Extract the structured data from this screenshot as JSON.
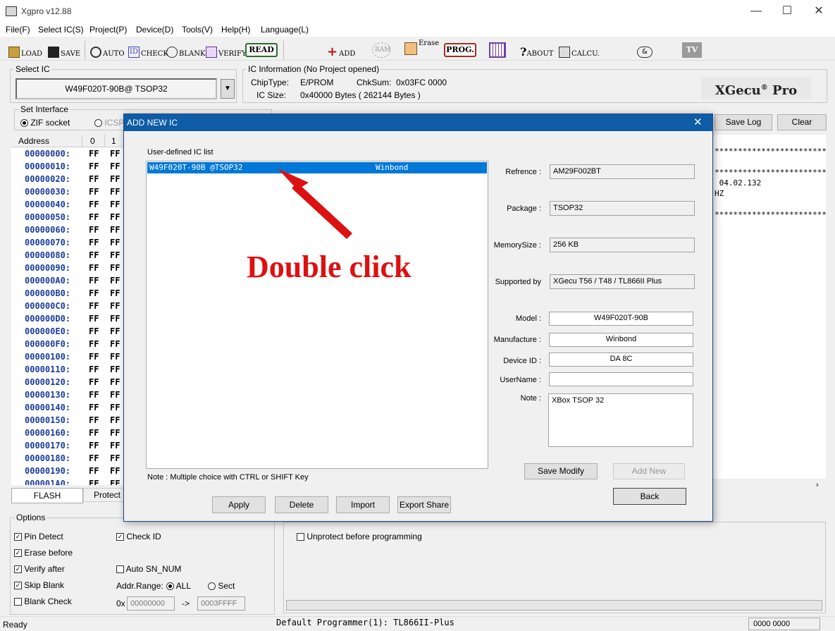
{
  "window": {
    "title": "Xgpro v12.88",
    "min": "—",
    "max": "☐",
    "close": "✕"
  },
  "menu": [
    "File(F)",
    "Select IC(S)",
    "Project(P)",
    "Device(D)",
    "Tools(V)",
    "Help(H)",
    "Language(L)"
  ],
  "toolbar": {
    "load": "LOAD",
    "save": "SAVE",
    "auto": "AUTO",
    "check": "CHECK",
    "blank": "BLANK",
    "verify": "VERIFY",
    "read": "READ",
    "add": "ADD",
    "ram": "RAM",
    "erase": "Erase",
    "prog": "PROG.",
    "about": "ABOUT",
    "calcu": "CALCU.",
    "logic": "&",
    "tv": "TV"
  },
  "select_ic": {
    "label": "Select IC",
    "value": "W49F020T-90B@ TSOP32"
  },
  "ic_info": {
    "label": "IC Information (No Project opened)",
    "chiptype_label": "ChipType:",
    "chiptype": "E/PROM",
    "chksum_label": "ChkSum:",
    "chksum": "0x03FC 0000",
    "icsize_label": "IC Size:",
    "icsize": "0x40000 Bytes ( 262144 Bytes )",
    "brand": "XGecu",
    "brand_mark": "®",
    "brand_suffix": "Pro"
  },
  "interface": {
    "label": "Set Interface",
    "zif": "ZIF socket",
    "icsp": "ICSP"
  },
  "log": {
    "save_log": "Save Log",
    "clear": "Clear",
    "lines": [
      "*******************************",
      "",
      "*******************************",
      " 04.02.132",
      "HZ",
      "",
      "*******************************"
    ]
  },
  "hex": {
    "col_address": "Address",
    "col0": "0",
    "col1": "1",
    "rows": [
      {
        "addr": "00000000:",
        "v0": "FF",
        "v1": "FF"
      },
      {
        "addr": "00000010:",
        "v0": "FF",
        "v1": "FF"
      },
      {
        "addr": "00000020:",
        "v0": "FF",
        "v1": "FF"
      },
      {
        "addr": "00000030:",
        "v0": "FF",
        "v1": "FF"
      },
      {
        "addr": "00000040:",
        "v0": "FF",
        "v1": "FF"
      },
      {
        "addr": "00000050:",
        "v0": "FF",
        "v1": "FF"
      },
      {
        "addr": "00000060:",
        "v0": "FF",
        "v1": "FF"
      },
      {
        "addr": "00000070:",
        "v0": "FF",
        "v1": "FF"
      },
      {
        "addr": "00000080:",
        "v0": "FF",
        "v1": "FF"
      },
      {
        "addr": "00000090:",
        "v0": "FF",
        "v1": "FF"
      },
      {
        "addr": "000000A0:",
        "v0": "FF",
        "v1": "FF"
      },
      {
        "addr": "000000B0:",
        "v0": "FF",
        "v1": "FF"
      },
      {
        "addr": "000000C0:",
        "v0": "FF",
        "v1": "FF"
      },
      {
        "addr": "000000D0:",
        "v0": "FF",
        "v1": "FF"
      },
      {
        "addr": "000000E0:",
        "v0": "FF",
        "v1": "FF"
      },
      {
        "addr": "000000F0:",
        "v0": "FF",
        "v1": "FF"
      },
      {
        "addr": "00000100:",
        "v0": "FF",
        "v1": "FF"
      },
      {
        "addr": "00000110:",
        "v0": "FF",
        "v1": "FF"
      },
      {
        "addr": "00000120:",
        "v0": "FF",
        "v1": "FF"
      },
      {
        "addr": "00000130:",
        "v0": "FF",
        "v1": "FF"
      },
      {
        "addr": "00000140:",
        "v0": "FF",
        "v1": "FF"
      },
      {
        "addr": "00000150:",
        "v0": "FF",
        "v1": "FF"
      },
      {
        "addr": "00000160:",
        "v0": "FF",
        "v1": "FF"
      },
      {
        "addr": "00000170:",
        "v0": "FF",
        "v1": "FF"
      },
      {
        "addr": "00000180:",
        "v0": "FF",
        "v1": "FF"
      },
      {
        "addr": "00000190:",
        "v0": "FF",
        "v1": "FF"
      },
      {
        "addr": "000001A0:",
        "v0": "FF",
        "v1": "FF"
      }
    ]
  },
  "tabs": {
    "flash": "FLASH",
    "protect": "Protect"
  },
  "options": {
    "label": "Options",
    "pin_detect": "Pin Detect",
    "check_id": "Check ID",
    "erase_before": "Erase before",
    "verify_after": "Verify after",
    "auto_sn": "Auto SN_NUM",
    "skip_blank": "Skip Blank",
    "addr_range": "Addr.Range:",
    "all": "ALL",
    "sect": "Sect",
    "blank_check": "Blank Check",
    "ox": "0x",
    "from": "00000000",
    "arrow": "->",
    "to": "0003FFFF",
    "check": "✓"
  },
  "protect": {
    "unprotect": "Unprotect before programming"
  },
  "status": {
    "ready": "Ready",
    "programmer": "Default Programmer(1): TL866II-Plus",
    "code": "0000 0000"
  },
  "dialog": {
    "title": "ADD NEW IC",
    "close": "✕",
    "list_label": "User-defined IC list",
    "items": [
      {
        "name": "W49F020T-90B @TSOP32",
        "maker": "Winbond"
      }
    ],
    "annotation": "Double click",
    "note_hint": "Note : Multiple choice with CTRL or SHIFT Key",
    "fields": {
      "refrence_label": "Refrence :",
      "refrence": "AM29F002BT",
      "package_label": "Package :",
      "package": "TSOP32",
      "memsize_label": "MemorySize :",
      "memsize": "256 KB",
      "supported_label": "Supported by",
      "supported": "XGecu T56 / T48 / TL866II Plus",
      "model_label": "Model :",
      "model": "W49F020T-90B",
      "manufacture_label": "Manufacture :",
      "manufacture": "Winbond",
      "deviceid_label": "Device ID :",
      "deviceid": "DA 8C",
      "username_label": "UserName :",
      "username": "",
      "note_label": "Note :",
      "note": "XBox TSOP 32"
    },
    "buttons": {
      "save_modify": "Save Modify",
      "add_new": "Add New",
      "back": "Back",
      "apply": "Apply",
      "delete": "Delete",
      "import": "Import",
      "export": "Export Share"
    }
  },
  "colors": {
    "accent": "#0f5ca6",
    "annotation": "#dd1111",
    "addr": "#1a3c9e"
  }
}
